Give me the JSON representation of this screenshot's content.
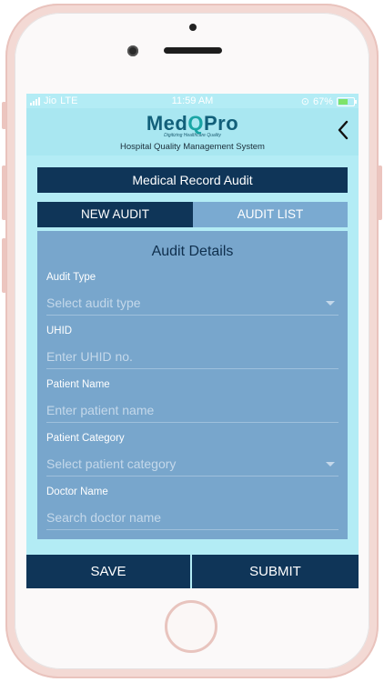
{
  "status_bar": {
    "carrier": "Jio",
    "network": "LTE",
    "time": "11:59 AM",
    "battery": "67%"
  },
  "header": {
    "logo_part1": "Med",
    "logo_part2": "Q",
    "logo_part3": "Pro",
    "tagline": "Digitizing Healthcare Quality",
    "subtitle": "Hospital Quality Management System",
    "back_icon": "chevron-left-icon"
  },
  "page_title": "Medical Record Audit",
  "tabs": [
    {
      "label": "NEW AUDIT",
      "active": true
    },
    {
      "label": "AUDIT LIST",
      "active": false
    }
  ],
  "form": {
    "title": "Audit Details",
    "fields": [
      {
        "label": "Audit Type",
        "placeholder": "Select audit type",
        "type": "dropdown"
      },
      {
        "label": "UHID",
        "placeholder": "Enter UHID no.",
        "type": "text"
      },
      {
        "label": "Patient Name",
        "placeholder": "Enter patient name",
        "type": "text"
      },
      {
        "label": "Patient Category",
        "placeholder": "Select patient category",
        "type": "dropdown"
      },
      {
        "label": "Doctor Name",
        "placeholder": "Search doctor name",
        "type": "text"
      }
    ]
  },
  "buttons": {
    "save": "SAVE",
    "submit": "SUBMIT"
  },
  "colors": {
    "primary": "#0f3558",
    "screen_bg": "#b3ecf5",
    "form_bg": "#78a6cc",
    "inactive_tab": "#7aaad1"
  }
}
